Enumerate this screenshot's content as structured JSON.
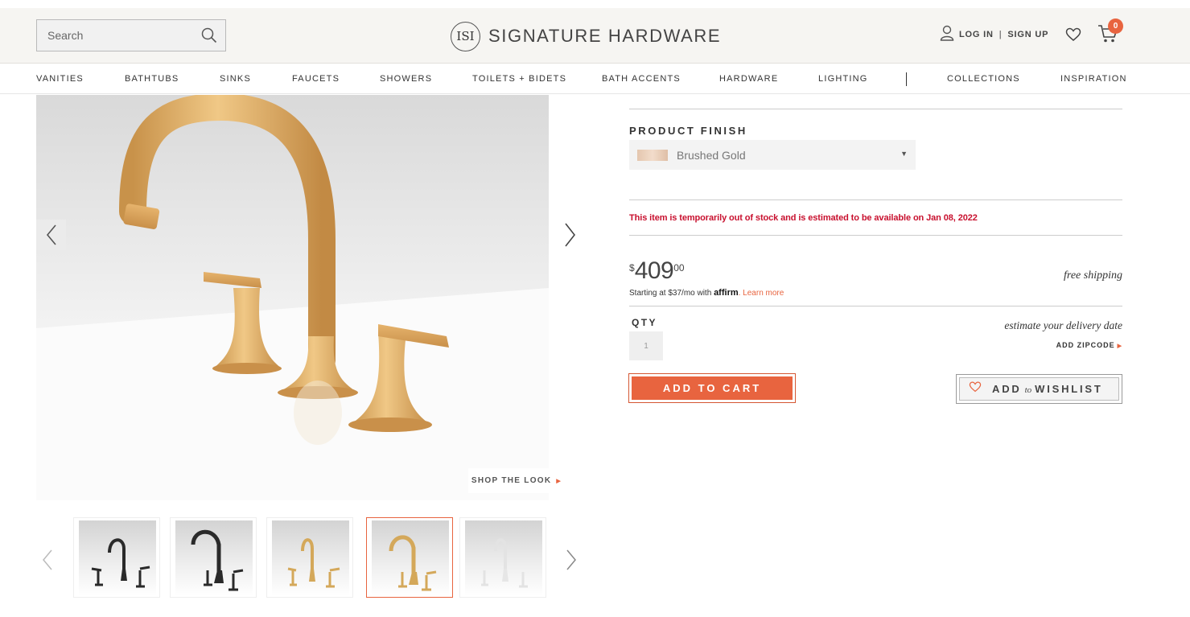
{
  "header": {
    "search_placeholder": "Search",
    "brand_mark": "ISI",
    "brand_name": "SIGNATURE HARDWARE",
    "login_label": "LOG IN",
    "separator": "|",
    "signup_label": "SIGN UP",
    "cart_count": "0",
    "icons": [
      "search-icon",
      "user-icon",
      "heart-icon",
      "cart-icon"
    ]
  },
  "nav": {
    "items": [
      "VANITIES",
      "BATHTUBS",
      "SINKS",
      "FAUCETS",
      "SHOWERS",
      "TOILETS + BIDETS",
      "BATH ACCENTS",
      "HARDWARE",
      "LIGHTING",
      "COLLECTIONS",
      "INSPIRATION"
    ]
  },
  "gallery": {
    "shop_the_look": "SHOP THE LOOK",
    "thumbnails": [
      {
        "finish": "matte black",
        "color": "#2a2a2a"
      },
      {
        "finish": "matte black",
        "color": "#2a2a2a"
      },
      {
        "finish": "brushed gold",
        "color": "#d4a85a"
      },
      {
        "finish": "brushed gold",
        "color": "#d4a85a"
      },
      {
        "finish": "chrome",
        "color": "#e3e3e3"
      }
    ],
    "active_thumbnail": 3
  },
  "product": {
    "finish_label": "PRODUCT FINISH",
    "finish_value": "Brushed Gold",
    "stock_message": "This item is temporarily out of stock and is estimated to be available on Jan 08, 2022",
    "price_currency": "$",
    "price_dollars": "409",
    "price_cents": "00",
    "free_shipping": "free shipping",
    "financing_prefix": "Starting at $37/mo with",
    "financing_brand": "affirm",
    "financing_link": ". Learn more",
    "qty_label": "QTY",
    "qty_value": "1",
    "estimate_delivery": "estimate your delivery date",
    "add_zipcode": "ADD ZIPCODE",
    "add_to_cart": "ADD TO CART",
    "wishlist_add": "ADD",
    "wishlist_to": "to",
    "wishlist_word": "WISHLIST"
  },
  "colors": {
    "accent": "#e8643f",
    "alert": "#c8102e",
    "header_bg": "#f6f5f2"
  }
}
